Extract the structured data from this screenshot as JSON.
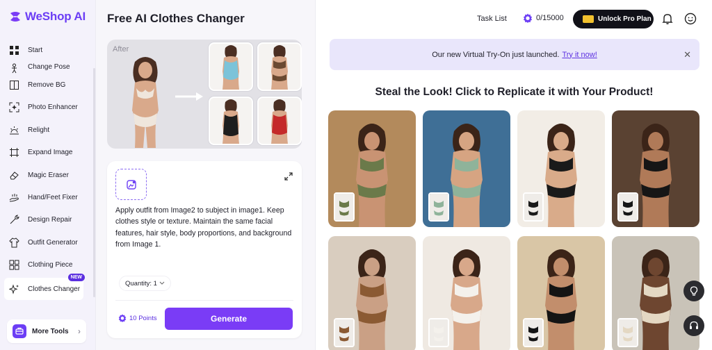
{
  "app": {
    "brand": "WeShop AI"
  },
  "sidebar": {
    "items": [
      {
        "label": "Start",
        "icon": "grid-icon"
      },
      {
        "label": "Change Pose",
        "icon": "pose-icon"
      },
      {
        "label": "Remove BG",
        "icon": "remove-bg-icon"
      },
      {
        "label": "Photo Enhancer",
        "icon": "enhance-icon"
      },
      {
        "label": "Relight",
        "icon": "relight-icon"
      },
      {
        "label": "Expand Image",
        "icon": "expand-image-icon"
      },
      {
        "label": "Magic Eraser",
        "icon": "eraser-icon"
      },
      {
        "label": "Hand/Feet Fixer",
        "icon": "hand-icon"
      },
      {
        "label": "Design Repair",
        "icon": "repair-icon"
      },
      {
        "label": "Outfit Generator",
        "icon": "outfit-icon"
      },
      {
        "label": "Clothing Piece",
        "icon": "clothing-piece-icon"
      },
      {
        "label": "Clothes Changer",
        "icon": "sparkle-icon",
        "badge": "NEW",
        "active": true
      }
    ],
    "more_tools": "More Tools"
  },
  "middle": {
    "title": "Free AI Clothes Changer",
    "preview_label": "After",
    "prompt": "Apply outfit from Image2 to subject in image1. Keep clothes style or texture. Maintain the same facial features, hair style, body proportions, and background from Image 1.",
    "quantity_label": "Quantity: 1",
    "points": "10 Points",
    "generate": "Generate"
  },
  "topbar": {
    "task_list": "Task List",
    "credits": "0/15000",
    "unlock": "Unlock Pro Plan"
  },
  "banner": {
    "text": "Our new Virtual Try-On just launched.",
    "link": "Try it now!",
    "close": "✕"
  },
  "gallery": {
    "title": "Steal the Look! Click to Replicate it with Your Product!",
    "cards": [
      {
        "bg": "#b38a5c",
        "fg": "#6b7a4a",
        "skin": "#c99373"
      },
      {
        "bg": "#3f6f96",
        "fg": "#8fb39a",
        "skin": "#d6a482"
      },
      {
        "bg": "#f2ede6",
        "fg": "#1a1a1a",
        "skin": "#d9ab8a"
      },
      {
        "bg": "#5a4232",
        "fg": "#161616",
        "skin": "#b07a58"
      },
      {
        "bg": "#d9cdbf",
        "fg": "#8b5a33",
        "skin": "#caa085"
      },
      {
        "bg": "#efe9e2",
        "fg": "#f4f1ec",
        "skin": "#d8a88a"
      },
      {
        "bg": "#d9c6a6",
        "fg": "#141414",
        "skin": "#c28e6c"
      },
      {
        "bg": "#c9c3b8",
        "fg": "#e4d8c3",
        "skin": "#6e4630"
      }
    ]
  },
  "colors": {
    "accent": "#7a3cf6",
    "banner_bg": "#e9e6fb",
    "sidebar_bg": "#f4f2fb"
  }
}
